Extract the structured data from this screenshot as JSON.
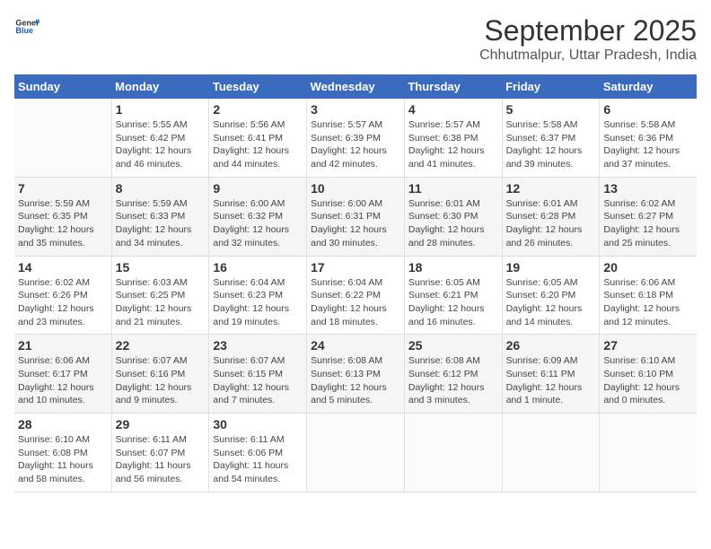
{
  "logo": {
    "text_general": "General",
    "text_blue": "Blue"
  },
  "title": "September 2025",
  "subtitle": "Chhutmalpur, Uttar Pradesh, India",
  "weekdays": [
    "Sunday",
    "Monday",
    "Tuesday",
    "Wednesday",
    "Thursday",
    "Friday",
    "Saturday"
  ],
  "weeks": [
    [
      {
        "day": "",
        "info": ""
      },
      {
        "day": "1",
        "info": "Sunrise: 5:55 AM\nSunset: 6:42 PM\nDaylight: 12 hours\nand 46 minutes."
      },
      {
        "day": "2",
        "info": "Sunrise: 5:56 AM\nSunset: 6:41 PM\nDaylight: 12 hours\nand 44 minutes."
      },
      {
        "day": "3",
        "info": "Sunrise: 5:57 AM\nSunset: 6:39 PM\nDaylight: 12 hours\nand 42 minutes."
      },
      {
        "day": "4",
        "info": "Sunrise: 5:57 AM\nSunset: 6:38 PM\nDaylight: 12 hours\nand 41 minutes."
      },
      {
        "day": "5",
        "info": "Sunrise: 5:58 AM\nSunset: 6:37 PM\nDaylight: 12 hours\nand 39 minutes."
      },
      {
        "day": "6",
        "info": "Sunrise: 5:58 AM\nSunset: 6:36 PM\nDaylight: 12 hours\nand 37 minutes."
      }
    ],
    [
      {
        "day": "7",
        "info": "Sunrise: 5:59 AM\nSunset: 6:35 PM\nDaylight: 12 hours\nand 35 minutes."
      },
      {
        "day": "8",
        "info": "Sunrise: 5:59 AM\nSunset: 6:33 PM\nDaylight: 12 hours\nand 34 minutes."
      },
      {
        "day": "9",
        "info": "Sunrise: 6:00 AM\nSunset: 6:32 PM\nDaylight: 12 hours\nand 32 minutes."
      },
      {
        "day": "10",
        "info": "Sunrise: 6:00 AM\nSunset: 6:31 PM\nDaylight: 12 hours\nand 30 minutes."
      },
      {
        "day": "11",
        "info": "Sunrise: 6:01 AM\nSunset: 6:30 PM\nDaylight: 12 hours\nand 28 minutes."
      },
      {
        "day": "12",
        "info": "Sunrise: 6:01 AM\nSunset: 6:28 PM\nDaylight: 12 hours\nand 26 minutes."
      },
      {
        "day": "13",
        "info": "Sunrise: 6:02 AM\nSunset: 6:27 PM\nDaylight: 12 hours\nand 25 minutes."
      }
    ],
    [
      {
        "day": "14",
        "info": "Sunrise: 6:02 AM\nSunset: 6:26 PM\nDaylight: 12 hours\nand 23 minutes."
      },
      {
        "day": "15",
        "info": "Sunrise: 6:03 AM\nSunset: 6:25 PM\nDaylight: 12 hours\nand 21 minutes."
      },
      {
        "day": "16",
        "info": "Sunrise: 6:04 AM\nSunset: 6:23 PM\nDaylight: 12 hours\nand 19 minutes."
      },
      {
        "day": "17",
        "info": "Sunrise: 6:04 AM\nSunset: 6:22 PM\nDaylight: 12 hours\nand 18 minutes."
      },
      {
        "day": "18",
        "info": "Sunrise: 6:05 AM\nSunset: 6:21 PM\nDaylight: 12 hours\nand 16 minutes."
      },
      {
        "day": "19",
        "info": "Sunrise: 6:05 AM\nSunset: 6:20 PM\nDaylight: 12 hours\nand 14 minutes."
      },
      {
        "day": "20",
        "info": "Sunrise: 6:06 AM\nSunset: 6:18 PM\nDaylight: 12 hours\nand 12 minutes."
      }
    ],
    [
      {
        "day": "21",
        "info": "Sunrise: 6:06 AM\nSunset: 6:17 PM\nDaylight: 12 hours\nand 10 minutes."
      },
      {
        "day": "22",
        "info": "Sunrise: 6:07 AM\nSunset: 6:16 PM\nDaylight: 12 hours\nand 9 minutes."
      },
      {
        "day": "23",
        "info": "Sunrise: 6:07 AM\nSunset: 6:15 PM\nDaylight: 12 hours\nand 7 minutes."
      },
      {
        "day": "24",
        "info": "Sunrise: 6:08 AM\nSunset: 6:13 PM\nDaylight: 12 hours\nand 5 minutes."
      },
      {
        "day": "25",
        "info": "Sunrise: 6:08 AM\nSunset: 6:12 PM\nDaylight: 12 hours\nand 3 minutes."
      },
      {
        "day": "26",
        "info": "Sunrise: 6:09 AM\nSunset: 6:11 PM\nDaylight: 12 hours\nand 1 minute."
      },
      {
        "day": "27",
        "info": "Sunrise: 6:10 AM\nSunset: 6:10 PM\nDaylight: 12 hours\nand 0 minutes."
      }
    ],
    [
      {
        "day": "28",
        "info": "Sunrise: 6:10 AM\nSunset: 6:08 PM\nDaylight: 11 hours\nand 58 minutes."
      },
      {
        "day": "29",
        "info": "Sunrise: 6:11 AM\nSunset: 6:07 PM\nDaylight: 11 hours\nand 56 minutes."
      },
      {
        "day": "30",
        "info": "Sunrise: 6:11 AM\nSunset: 6:06 PM\nDaylight: 11 hours\nand 54 minutes."
      },
      {
        "day": "",
        "info": ""
      },
      {
        "day": "",
        "info": ""
      },
      {
        "day": "",
        "info": ""
      },
      {
        "day": "",
        "info": ""
      }
    ]
  ]
}
